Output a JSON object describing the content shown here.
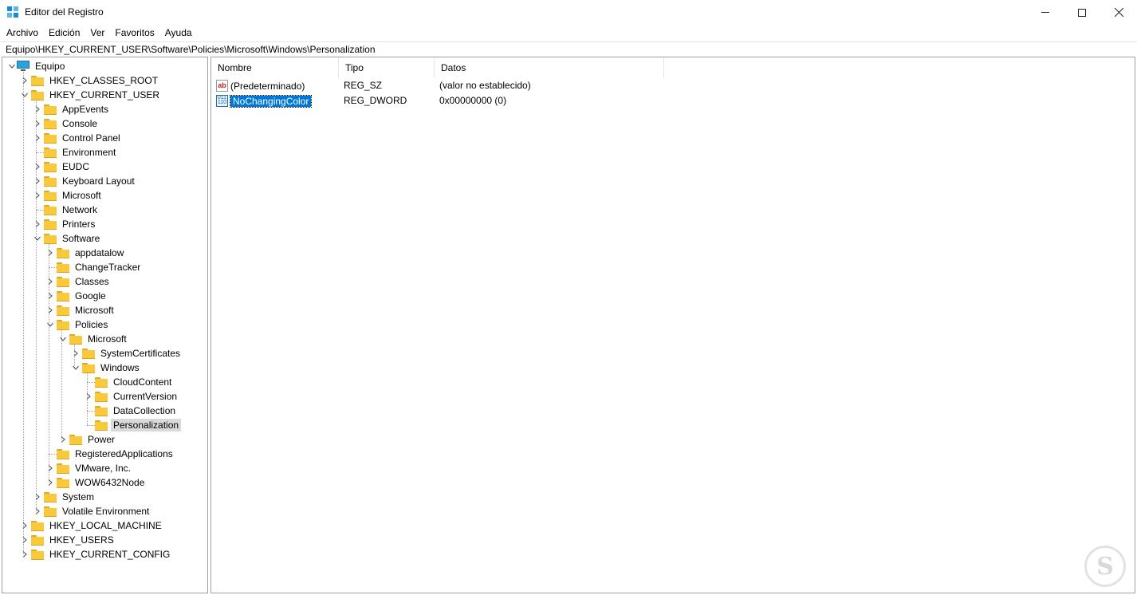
{
  "window": {
    "title": "Editor del Registro"
  },
  "menu": [
    "Archivo",
    "Edición",
    "Ver",
    "Favoritos",
    "Ayuda"
  ],
  "address": "Equipo\\HKEY_CURRENT_USER\\Software\\Policies\\Microsoft\\Windows\\Personalization",
  "tree": [
    {
      "label": "Equipo",
      "level": 0,
      "expand": "open",
      "icon": "computer-icon"
    },
    {
      "label": "HKEY_CLASSES_ROOT",
      "level": 1,
      "expand": "closed"
    },
    {
      "label": "HKEY_CURRENT_USER",
      "level": 1,
      "expand": "open"
    },
    {
      "label": "AppEvents",
      "level": 2,
      "expand": "closed"
    },
    {
      "label": "Console",
      "level": 2,
      "expand": "closed"
    },
    {
      "label": "Control Panel",
      "level": 2,
      "expand": "closed"
    },
    {
      "label": "Environment",
      "level": 2,
      "expand": "none"
    },
    {
      "label": "EUDC",
      "level": 2,
      "expand": "closed"
    },
    {
      "label": "Keyboard Layout",
      "level": 2,
      "expand": "closed"
    },
    {
      "label": "Microsoft",
      "level": 2,
      "expand": "closed"
    },
    {
      "label": "Network",
      "level": 2,
      "expand": "none"
    },
    {
      "label": "Printers",
      "level": 2,
      "expand": "closed"
    },
    {
      "label": "Software",
      "level": 2,
      "expand": "open"
    },
    {
      "label": "appdatalow",
      "level": 3,
      "expand": "closed"
    },
    {
      "label": "ChangeTracker",
      "level": 3,
      "expand": "none"
    },
    {
      "label": "Classes",
      "level": 3,
      "expand": "closed"
    },
    {
      "label": "Google",
      "level": 3,
      "expand": "closed"
    },
    {
      "label": "Microsoft",
      "level": 3,
      "expand": "closed"
    },
    {
      "label": "Policies",
      "level": 3,
      "expand": "open"
    },
    {
      "label": "Microsoft",
      "level": 4,
      "expand": "open"
    },
    {
      "label": "SystemCertificates",
      "level": 5,
      "expand": "closed"
    },
    {
      "label": "Windows",
      "level": 5,
      "expand": "open"
    },
    {
      "label": "CloudContent",
      "level": 6,
      "expand": "none"
    },
    {
      "label": "CurrentVersion",
      "level": 6,
      "expand": "closed"
    },
    {
      "label": "DataCollection",
      "level": 6,
      "expand": "none"
    },
    {
      "label": "Personalization",
      "level": 6,
      "expand": "none",
      "selected": true
    },
    {
      "label": "Power",
      "level": 4,
      "expand": "closed"
    },
    {
      "label": "RegisteredApplications",
      "level": 3,
      "expand": "none"
    },
    {
      "label": "VMware, Inc.",
      "level": 3,
      "expand": "closed"
    },
    {
      "label": "WOW6432Node",
      "level": 3,
      "expand": "closed"
    },
    {
      "label": "System",
      "level": 2,
      "expand": "closed"
    },
    {
      "label": "Volatile Environment",
      "level": 2,
      "expand": "closed"
    },
    {
      "label": "HKEY_LOCAL_MACHINE",
      "level": 1,
      "expand": "closed"
    },
    {
      "label": "HKEY_USERS",
      "level": 1,
      "expand": "closed"
    },
    {
      "label": "HKEY_CURRENT_CONFIG",
      "level": 1,
      "expand": "closed"
    }
  ],
  "list": {
    "columns": [
      "Nombre",
      "Tipo",
      "Datos"
    ],
    "rows": [
      {
        "name": "(Predeterminado)",
        "type": "REG_SZ",
        "data": "(valor no establecido)",
        "icon": "string-value-icon",
        "selected": false
      },
      {
        "name": "NoChangingColor",
        "type": "REG_DWORD",
        "data": "0x00000000 (0)",
        "icon": "binary-value-icon",
        "selected": true
      }
    ]
  },
  "watermark": {
    "glyph": "S"
  },
  "colors": {
    "selection": "#0078d7",
    "tree_selection": "#d9d9d9",
    "folder": "#f8c93b"
  }
}
